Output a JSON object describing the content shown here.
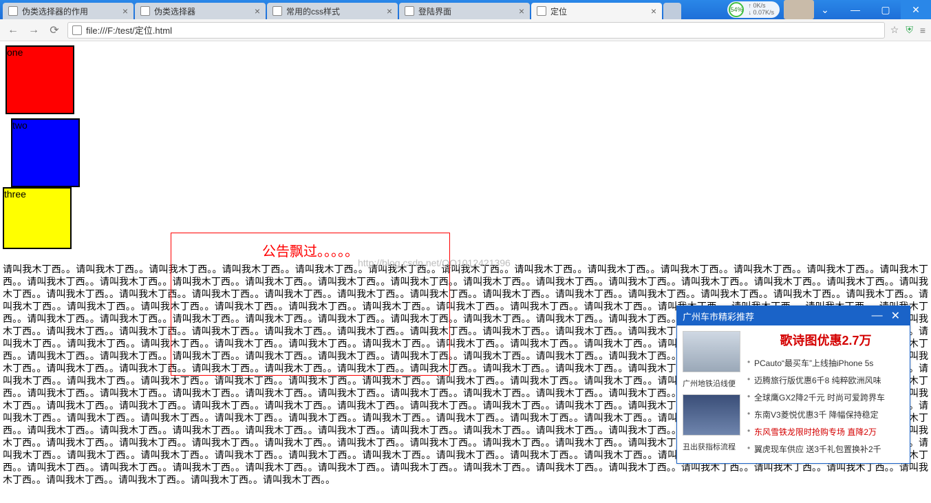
{
  "browser": {
    "tabs": [
      {
        "title": "伪类选择器的作用"
      },
      {
        "title": "伪类选择器"
      },
      {
        "title": "常用的css样式"
      },
      {
        "title": "登陆界面"
      },
      {
        "title": "定位"
      }
    ],
    "active_tab": 4,
    "url": "file:///F:/test/定位.html",
    "speed_percent": "54%",
    "speed_up": "0K/s",
    "speed_down": "0.07K/s"
  },
  "boxes": {
    "one": "one",
    "two": "two",
    "three": "three"
  },
  "marquee_text": "公告飘过。。。。。",
  "watermark": "http://blog.csdn.net/QQ1012421396",
  "body_phrase": "请叫我木丁西。。",
  "body_repeat": 220,
  "ad": {
    "header": "广州车市精彩推荐",
    "title": "歌诗图优惠2.7万",
    "caption1": "广州地铁沿线便",
    "caption2": "丑出获指标流程",
    "items": [
      "PCauto“最买车”上线抽iPhone 5s",
      "迈腾旅行版优惠6千8 纯粹欧洲风味",
      "全球鹰GX2降2千元 时尚可爱跨界车",
      "东南V3菱悦优惠3千 降幅保持稳定",
      "东风雪铁龙限时抢购专场 直降2万",
      "翼虎现车供应 送3千礼包置换补2千"
    ],
    "hot_index": 4
  }
}
